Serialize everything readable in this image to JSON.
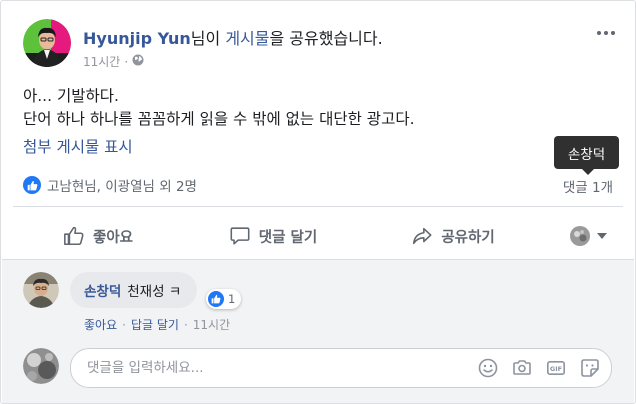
{
  "post": {
    "author": "Hyunjip Yun",
    "suffix_1": "님이 ",
    "shared_link": "게시물",
    "suffix_2": "을 공유했습니다.",
    "time": "11시간",
    "privacy_icon": "globe-icon",
    "text_lines": [
      "아... 기발하다.",
      "단어 하나 하나를 꼼꼼하게 읽을 수 밖에 없는 대단한 광고다."
    ],
    "attachment_link": "첨부 게시물 표시"
  },
  "tooltip": {
    "text": "손창덕"
  },
  "reactions": {
    "summary": "고남현님, 이광열님 외 2명",
    "comment_count": "댓글 1개"
  },
  "actions": {
    "like": "좋아요",
    "comment": "댓글 달기",
    "share": "공유하기"
  },
  "comment": {
    "author": "손창덕",
    "text": "천재성 ㅋ",
    "reaction_count": "1",
    "like_label": "좋아요",
    "reply_label": "답글 달기",
    "time": "11시간",
    "separator": "·"
  },
  "composer": {
    "placeholder": "댓글을 입력하세요..."
  },
  "colors": {
    "link": "#365899",
    "like_blue": "#2078f4",
    "muted": "#606770",
    "bg_comments": "#f2f3f5"
  }
}
